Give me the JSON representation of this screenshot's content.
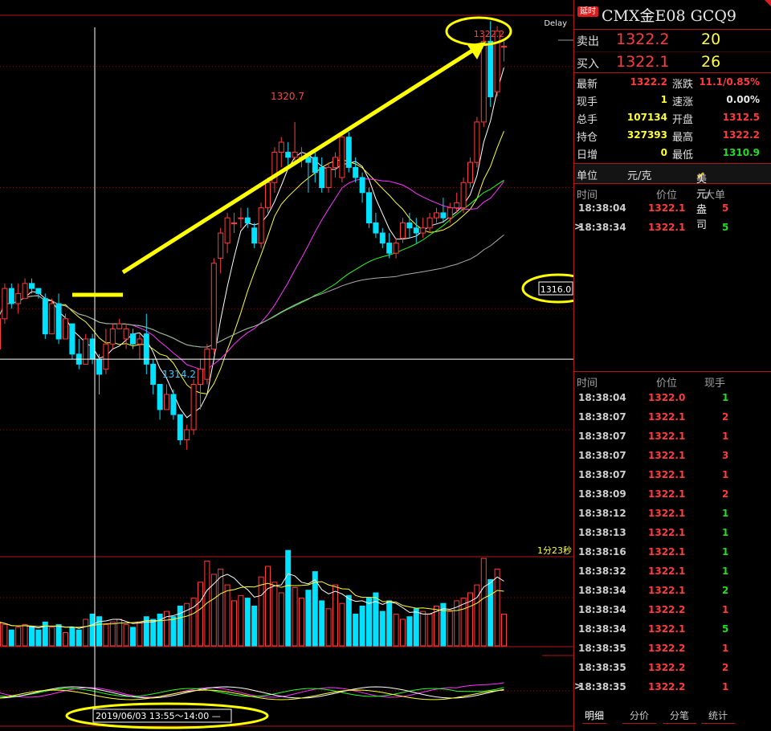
{
  "instrument": {
    "badge": "延时",
    "symbol": "CMX金E08",
    "code": "GCQ9"
  },
  "quote": {
    "ask_label": "卖出",
    "ask_price": "1322.2",
    "ask_vol": "20",
    "bid_label": "买入",
    "bid_price": "1322.1",
    "bid_vol": "26"
  },
  "stats": [
    {
      "l1": "最新",
      "v1": "1322.2",
      "c1": "red",
      "l2": "涨跌",
      "v2": "11.1/0.85%",
      "c2": "red"
    },
    {
      "l1": "现手",
      "v1": "1",
      "c1": "yellow",
      "l2": "速涨",
      "v2": "0.00%",
      "c2": "white"
    },
    {
      "l1": "总手",
      "v1": "107134",
      "c1": "yellow",
      "l2": "开盘",
      "v2": "1312.5",
      "c2": "red"
    },
    {
      "l1": "持仓",
      "v1": "327393",
      "c1": "yellow",
      "l2": "最高",
      "v2": "1322.2",
      "c2": "red"
    },
    {
      "l1": "日增",
      "v1": "0",
      "c1": "yellow",
      "l2": "最低",
      "v2": "1310.9",
      "c2": "green"
    }
  ],
  "unit": {
    "label": "单位",
    "value": "元/克",
    "alt": "美元/盎司"
  },
  "big_orders": {
    "headers": [
      "时间",
      "价位",
      "大单"
    ],
    "rows": [
      {
        "time": "18:38:04",
        "price": "1322.1",
        "qty": "5",
        "qc": "red",
        "mark": ""
      },
      {
        "time": "18:38:34",
        "price": "1322.1",
        "qty": "5",
        "qc": "green",
        "mark": ">"
      }
    ]
  },
  "ticks": {
    "headers": [
      "时间",
      "价位",
      "现手"
    ],
    "rows": [
      {
        "time": "18:38:04",
        "price": "1322.0",
        "qty": "1",
        "qc": "green",
        "mark": ""
      },
      {
        "time": "18:38:07",
        "price": "1322.1",
        "qty": "2",
        "qc": "red",
        "mark": ""
      },
      {
        "time": "18:38:07",
        "price": "1322.1",
        "qty": "1",
        "qc": "red",
        "mark": ""
      },
      {
        "time": "18:38:07",
        "price": "1322.1",
        "qty": "3",
        "qc": "red",
        "mark": ""
      },
      {
        "time": "18:38:07",
        "price": "1322.1",
        "qty": "1",
        "qc": "red",
        "mark": ""
      },
      {
        "time": "18:38:09",
        "price": "1322.1",
        "qty": "2",
        "qc": "red",
        "mark": ""
      },
      {
        "time": "18:38:12",
        "price": "1322.1",
        "qty": "1",
        "qc": "green",
        "mark": ""
      },
      {
        "time": "18:38:13",
        "price": "1322.1",
        "qty": "1",
        "qc": "green",
        "mark": ""
      },
      {
        "time": "18:38:16",
        "price": "1322.1",
        "qty": "1",
        "qc": "green",
        "mark": ""
      },
      {
        "time": "18:38:32",
        "price": "1322.1",
        "qty": "1",
        "qc": "green",
        "mark": ""
      },
      {
        "time": "18:38:34",
        "price": "1322.1",
        "qty": "2",
        "qc": "green",
        "mark": ""
      },
      {
        "time": "18:38:34",
        "price": "1322.2",
        "qty": "1",
        "qc": "red",
        "mark": ""
      },
      {
        "time": "18:38:34",
        "price": "1322.1",
        "qty": "5",
        "qc": "green",
        "mark": ""
      },
      {
        "time": "18:38:35",
        "price": "1322.2",
        "qty": "1",
        "qc": "red",
        "mark": ""
      },
      {
        "time": "18:38:35",
        "price": "1322.2",
        "qty": "2",
        "qc": "red",
        "mark": ""
      },
      {
        "time": "18:38:35",
        "price": "1322.2",
        "qty": "1",
        "qc": "red",
        "mark": ">"
      }
    ]
  },
  "tabs": [
    "明细",
    "分价",
    "分笔",
    "统计"
  ],
  "colors": {
    "up": "#ff3b3b",
    "down": "#00e0ff",
    "border": "#b01818",
    "annot": "#ffff00"
  },
  "chart_data": {
    "type": "candlestick",
    "delay_label": "Delay",
    "countdown_label": "1分23秒",
    "crosshair_price_label": "1316.0",
    "crosshair_time_label": "2019/06/03 13:55～14:00 —",
    "high_label": "1320.7",
    "low_label": "1314.2",
    "last_label": "1322.2",
    "price_range": [
      1312.1,
      1322.8
    ],
    "candles": [
      [
        1316.2,
        1316.9,
        1316.1,
        1316.8
      ],
      [
        1316.8,
        1317.5,
        1316.7,
        1317.4
      ],
      [
        1317.4,
        1317.5,
        1317.0,
        1317.1
      ],
      [
        1317.1,
        1317.5,
        1316.9,
        1317.3
      ],
      [
        1317.2,
        1317.6,
        1317.2,
        1317.5
      ],
      [
        1317.5,
        1317.6,
        1317.3,
        1317.4
      ],
      [
        1317.4,
        1317.4,
        1317.2,
        1317.3
      ],
      [
        1317.2,
        1317.3,
        1316.4,
        1316.5
      ],
      [
        1316.5,
        1317.2,
        1316.5,
        1317.1
      ],
      [
        1317.1,
        1317.3,
        1316.3,
        1316.4
      ],
      [
        1316.4,
        1316.9,
        1316.4,
        1316.8
      ],
      [
        1316.7,
        1316.7,
        1316.0,
        1316.1
      ],
      [
        1316.1,
        1316.4,
        1315.8,
        1315.9
      ],
      [
        1315.9,
        1316.5,
        1315.9,
        1316.4
      ],
      [
        1316.4,
        1316.5,
        1315.9,
        1316.0
      ],
      [
        1316.0,
        1316.1,
        1315.3,
        1315.7
      ],
      [
        1315.8,
        1316.6,
        1315.7,
        1316.3
      ],
      [
        1316.3,
        1316.7,
        1316.2,
        1316.6
      ],
      [
        1316.6,
        1316.8,
        1316.6,
        1316.7
      ],
      [
        1316.4,
        1316.7,
        1316.2,
        1316.6
      ],
      [
        1316.5,
        1316.6,
        1316.2,
        1316.3
      ],
      [
        1316.3,
        1316.5,
        1316.0,
        1316.4
      ],
      [
        1316.5,
        1316.9,
        1315.7,
        1315.9
      ],
      [
        1315.9,
        1316.0,
        1315.3,
        1315.5
      ],
      [
        1315.5,
        1315.5,
        1314.8,
        1315.0
      ],
      [
        1315.0,
        1315.5,
        1315.0,
        1315.3
      ],
      [
        1315.3,
        1315.4,
        1314.8,
        1314.9
      ],
      [
        1314.9,
        1314.9,
        1314.3,
        1314.4
      ],
      [
        1314.4,
        1314.7,
        1314.2,
        1314.6
      ],
      [
        1314.6,
        1315.6,
        1314.5,
        1315.5
      ],
      [
        1315.5,
        1316.0,
        1315.0,
        1315.8
      ],
      [
        1315.6,
        1316.3,
        1315.5,
        1316.2
      ],
      [
        1316.2,
        1318.0,
        1316.1,
        1317.9
      ],
      [
        1318.0,
        1318.6,
        1317.7,
        1318.5
      ],
      [
        1318.3,
        1318.9,
        1318.1,
        1318.8
      ],
      [
        1318.7,
        1318.9,
        1318.5,
        1318.7
      ],
      [
        1318.8,
        1319.0,
        1318.6,
        1318.8
      ],
      [
        1318.8,
        1319.0,
        1318.6,
        1318.7
      ],
      [
        1318.6,
        1318.7,
        1318.2,
        1318.3
      ],
      [
        1318.3,
        1319.1,
        1318.2,
        1319.0
      ],
      [
        1319.0,
        1319.6,
        1318.9,
        1319.5
      ],
      [
        1319.5,
        1320.2,
        1319.3,
        1320.1
      ],
      [
        1320.1,
        1320.4,
        1319.8,
        1320.3
      ],
      [
        1320.1,
        1320.3,
        1319.8,
        1320.0
      ],
      [
        1320.0,
        1320.7,
        1319.9,
        1320.1
      ],
      [
        1320.0,
        1320.2,
        1319.8,
        1320.0
      ],
      [
        1320.0,
        1320.1,
        1319.3,
        1319.9
      ],
      [
        1320.0,
        1320.1,
        1319.5,
        1319.7
      ],
      [
        1319.8,
        1320.0,
        1319.3,
        1319.4
      ],
      [
        1319.4,
        1319.9,
        1319.3,
        1319.8
      ],
      [
        1319.8,
        1320.1,
        1319.6,
        1320.0
      ],
      [
        1319.6,
        1320.5,
        1319.5,
        1320.4
      ],
      [
        1320.4,
        1320.5,
        1319.7,
        1319.8
      ],
      [
        1319.8,
        1320.0,
        1319.5,
        1319.6
      ],
      [
        1319.6,
        1319.7,
        1319.1,
        1319.3
      ],
      [
        1319.3,
        1319.4,
        1318.6,
        1318.7
      ],
      [
        1318.7,
        1318.9,
        1318.4,
        1318.5
      ],
      [
        1318.5,
        1318.6,
        1318.2,
        1318.3
      ],
      [
        1318.3,
        1318.5,
        1318.0,
        1318.1
      ],
      [
        1318.1,
        1318.4,
        1318.0,
        1318.3
      ],
      [
        1318.4,
        1318.8,
        1318.3,
        1318.7
      ],
      [
        1318.7,
        1318.9,
        1318.4,
        1318.6
      ],
      [
        1318.6,
        1318.8,
        1318.3,
        1318.5
      ],
      [
        1318.5,
        1318.8,
        1318.4,
        1318.6
      ],
      [
        1318.6,
        1318.9,
        1318.5,
        1318.8
      ],
      [
        1318.8,
        1319.0,
        1318.7,
        1318.9
      ],
      [
        1318.9,
        1319.2,
        1318.7,
        1318.8
      ],
      [
        1318.8,
        1319.1,
        1318.7,
        1319.0
      ],
      [
        1319.0,
        1319.3,
        1318.9,
        1319.1
      ],
      [
        1319.0,
        1319.6,
        1318.9,
        1319.5
      ],
      [
        1319.5,
        1320.0,
        1319.4,
        1319.9
      ],
      [
        1319.9,
        1320.8,
        1319.8,
        1320.7
      ],
      [
        1320.7,
        1322.4,
        1320.6,
        1322.3
      ],
      [
        1322.3,
        1322.7,
        1321.0,
        1321.2
      ],
      [
        1321.3,
        1322.6,
        1321.2,
        1322.5
      ],
      [
        1322.2,
        1322.3,
        1321.9,
        1322.2
      ]
    ],
    "volumes": [
      9,
      8,
      6,
      7,
      8,
      7,
      6,
      9,
      7,
      8,
      5,
      7,
      6,
      10,
      12,
      11,
      8,
      9,
      10,
      8,
      7,
      9,
      11,
      10,
      12,
      13,
      11,
      15,
      16,
      18,
      24,
      32,
      27,
      29,
      23,
      17,
      19,
      18,
      15,
      26,
      30,
      24,
      20,
      36,
      22,
      18,
      21,
      28,
      17,
      14,
      23,
      16,
      19,
      12,
      15,
      18,
      20,
      13,
      17,
      12,
      10,
      11,
      14,
      13,
      12,
      15,
      16,
      13,
      17,
      18,
      20,
      23,
      33,
      25,
      29,
      12
    ]
  }
}
